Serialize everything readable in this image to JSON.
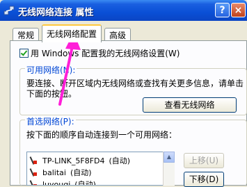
{
  "window": {
    "title": "无线网络连接 属性",
    "help_glyph": "?",
    "close_glyph": "×"
  },
  "tabs": [
    {
      "label": "常规"
    },
    {
      "label": "无线网络配置",
      "selected": true
    },
    {
      "label": "高级"
    }
  ],
  "windows_config": {
    "checked": true,
    "label": "用 Windows 配置我的无线网络设置(W)"
  },
  "available": {
    "legend": "可用网络(N):",
    "description": "要连接、断开区域内无线网络或查找有关更多信息，请单击下面的按钮。",
    "button": "查看无线网络"
  },
  "preferred": {
    "legend": "首选网络(P):",
    "description": "按下面的顺序自动连接到一个可用网络：",
    "networks": [
      {
        "name": "TP-LINK_5F8FD4",
        "mode": "(自动)"
      },
      {
        "name": "balitai",
        "mode": "(自动)"
      },
      {
        "name": "luyouqi",
        "mode": "(自动)"
      }
    ],
    "move_up": "上移(U)",
    "move_down": "下移(D)"
  },
  "colors": {
    "titlebar": "#0a4fd6",
    "accent_label": "#0046d5",
    "annotation_arrow": "#ff1fd8"
  }
}
